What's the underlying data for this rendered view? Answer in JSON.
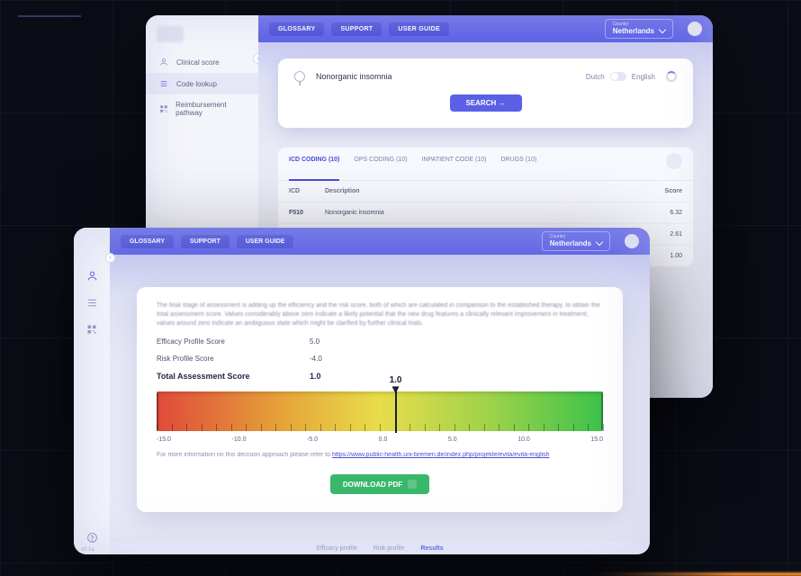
{
  "windowA": {
    "nav": {
      "glossary": "GLOSSARY",
      "support": "SUPPORT",
      "user_guide": "USER GUIDE"
    },
    "country": {
      "label": "Country",
      "value": "Netherlands"
    },
    "sidebar": [
      {
        "icon": "person",
        "label": "Clinical score"
      },
      {
        "icon": "list",
        "label": "Code lookup"
      },
      {
        "icon": "qrcode",
        "label": "Reimbursement pathway"
      }
    ],
    "search": {
      "query": "Nonorganic insomnia",
      "lang_left": "Dutch",
      "lang_right": "English",
      "button": "SEARCH  →"
    },
    "tabs": [
      {
        "label": "ICD CODING (10)",
        "active": true
      },
      {
        "label": "OPS CODING (10)"
      },
      {
        "label": "INPATIENT CODE (10)"
      },
      {
        "label": "DRUGS (10)"
      }
    ],
    "table": {
      "headers": {
        "code": "ICD",
        "desc": "Description",
        "score": "Score"
      },
      "rows": [
        {
          "code": "F510",
          "desc": "Nonorganic insomnia",
          "score": "6.32"
        },
        {
          "code": "",
          "desc": "",
          "score": "2.61"
        },
        {
          "code": "",
          "desc": "",
          "score": "1.00"
        }
      ]
    }
  },
  "windowB": {
    "nav": {
      "glossary": "GLOSSARY",
      "support": "SUPPORT",
      "user_guide": "USER GUIDE"
    },
    "country": {
      "label": "Country",
      "value": "Netherlands"
    },
    "blurb": "The final stage of assessment is adding up the efficiency and the risk score, both of which are calculated in comparison to the established therapy, to obtain the total assessment score. Values considerably above zero indicate a likely potential that the new drug features a clinically relevant improvement in treatment; values around zero indicate an ambiguous state which might be clarified by further clinical trials.",
    "scores": {
      "efficacy_label": "Efficacy Profile Score",
      "efficacy_value": "5.0",
      "risk_label": "Risk Profile Score",
      "risk_value": "-4.0",
      "total_label": "Total Assessment Score",
      "total_value": "1.0"
    },
    "gauge": {
      "min": -15,
      "max": 15,
      "value": 1.0,
      "value_label": "1.0",
      "ticks": [
        "-15.0",
        "-10.0",
        "-5.0",
        "0.0",
        "5.0",
        "10.0",
        "15.0"
      ]
    },
    "link_prefix": "For more information on this decision approach please refer to ",
    "link_text": "https://www.public-health.uni-bremen.de/index.php/projekte/evita/evita-english",
    "download": "DOWNLOAD PDF",
    "bottom_tabs": [
      "Efficacy profile",
      "Risk profile",
      "Results"
    ],
    "version": "v0.1a"
  }
}
